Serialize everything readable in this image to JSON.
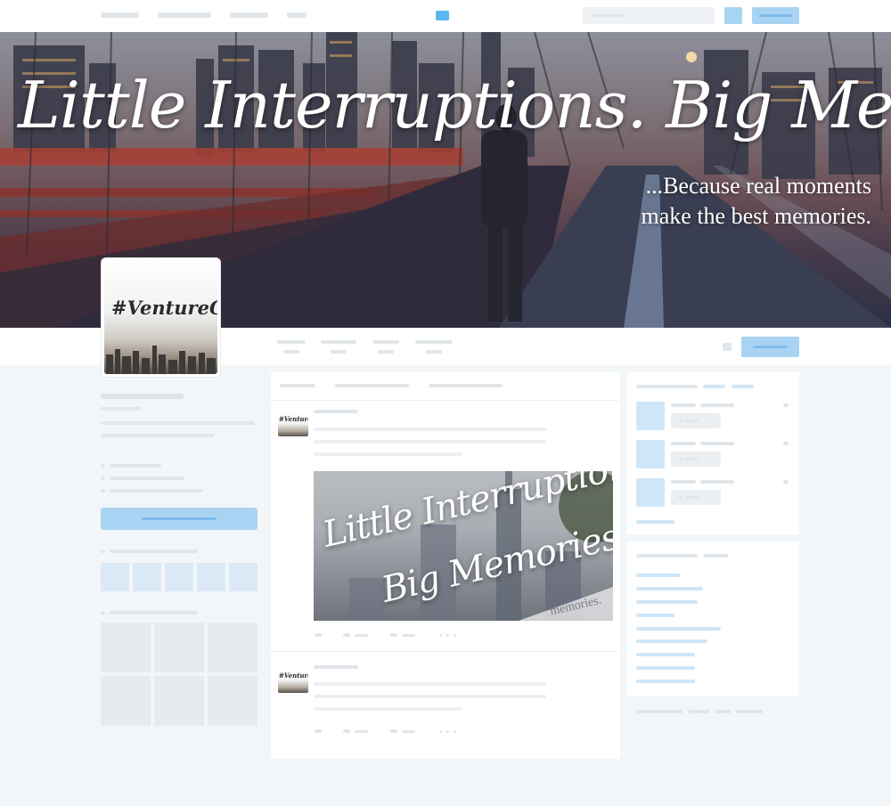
{
  "banner": {
    "headline": "Little Interruptions. Big Memories.",
    "tagline_line1": "...Because real moments",
    "tagline_line2": "make the best memories."
  },
  "profile": {
    "avatar_text": "#VentureOut"
  },
  "post": {
    "thumb_text": "#VentureOut",
    "image_headline_line1": "Little Interruptions.",
    "image_headline_line2": "Big Memories.",
    "image_watermark": "memories."
  },
  "colors": {
    "placeholder_gray": "#e1e6ea",
    "placeholder_blue": "#a9d3f3",
    "page_background": "#f3f6f8"
  }
}
